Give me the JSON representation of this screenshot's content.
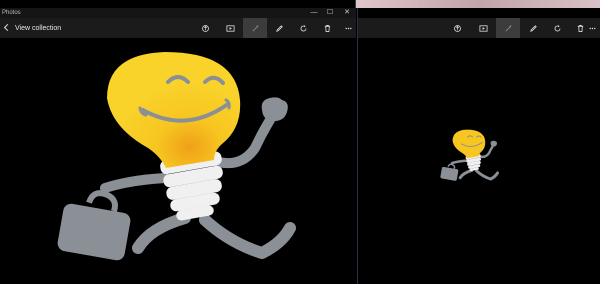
{
  "desktop": {
    "left_window_title": "Photos"
  },
  "left_window": {
    "nav": {
      "view_collection_label": "View collection"
    },
    "caption": {
      "minimize": "—",
      "maximize": "☐",
      "close": "✕"
    },
    "toolbar": [
      "share-icon",
      "slideshow-icon",
      "enhance-icon",
      "edit-icon",
      "rotate-icon",
      "delete-icon",
      "more-icon"
    ]
  },
  "right_window": {
    "toolbar": [
      "share-icon",
      "slideshow-icon",
      "enhance-icon",
      "edit-icon",
      "rotate-icon",
      "delete-icon",
      "more-icon"
    ]
  },
  "image": {
    "subject": "Cartoon lightbulb running with briefcase",
    "bulb_color": "#f5c518",
    "body_color": "#8a9096"
  },
  "colors": {
    "titlebar": "#151515",
    "toolbar": "#1b1b1b",
    "active_tool": "#3c3c3c",
    "divider": "#3a3f5a"
  }
}
